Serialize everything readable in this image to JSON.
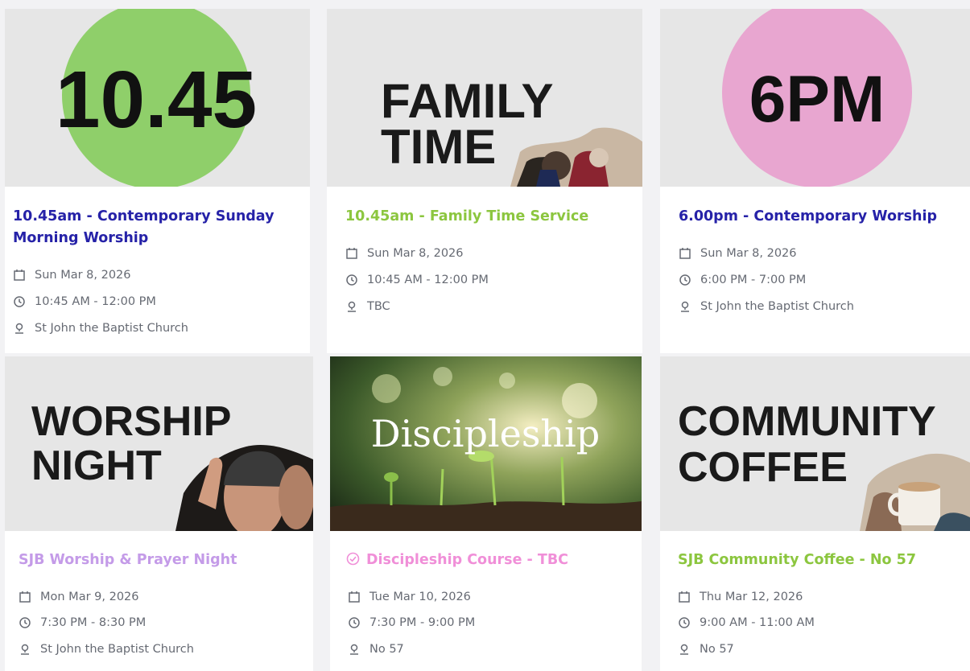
{
  "events": [
    {
      "image_text": "10.45",
      "title": "10.45am - Contemporary Sunday Morning Worship",
      "date": "Sun Mar 8, 2026",
      "time": "10:45 AM - 12:00 PM",
      "location": "St John the Baptist Church",
      "accent": "#2622a8",
      "badge_color": "#8fcf6a"
    },
    {
      "image_text_line1": "FAMILY",
      "image_text_line2": "TIME",
      "title": "10.45am - Family Time Service",
      "date": "Sun Mar 8, 2026",
      "time": "10:45 AM - 12:00 PM",
      "location": "TBC",
      "accent": "#8cc63f"
    },
    {
      "image_text": "6PM",
      "title": "6.00pm - Contemporary Worship",
      "date": "Sun Mar 8, 2026",
      "time": "6:00 PM - 7:00 PM",
      "location": "St John the Baptist Church",
      "accent": "#2622a8",
      "badge_color": "#e8a6d0"
    },
    {
      "image_text_line1": "WORSHIP",
      "image_text_line2": "NIGHT",
      "title": "SJB Worship & Prayer Night",
      "date": "Mon Mar 9, 2026",
      "time": "7:30 PM - 8:30 PM",
      "location": "St John the Baptist Church",
      "accent": "#c49be8"
    },
    {
      "image_text": "Discipleship",
      "title": "Discipleship Course - TBC",
      "date": "Tue Mar 10, 2026",
      "time": "7:30 PM - 9:00 PM",
      "location": "No 57",
      "accent": "#f08fd8"
    },
    {
      "image_text_line1": "COMMUNITY",
      "image_text_line2": "COFFEE",
      "title": "SJB Community Coffee - No 57",
      "date": "Thu Mar 12, 2026",
      "time": "9:00 AM - 11:00 AM",
      "location": "No 57",
      "accent": "#8cc63f"
    }
  ],
  "icons": {
    "date": "calendar-icon",
    "time": "clock-icon",
    "location": "location-pin-icon",
    "status": "check-circle-icon"
  },
  "colors": {
    "meta_text": "#666a73",
    "page_background": "#f2f2f4"
  }
}
